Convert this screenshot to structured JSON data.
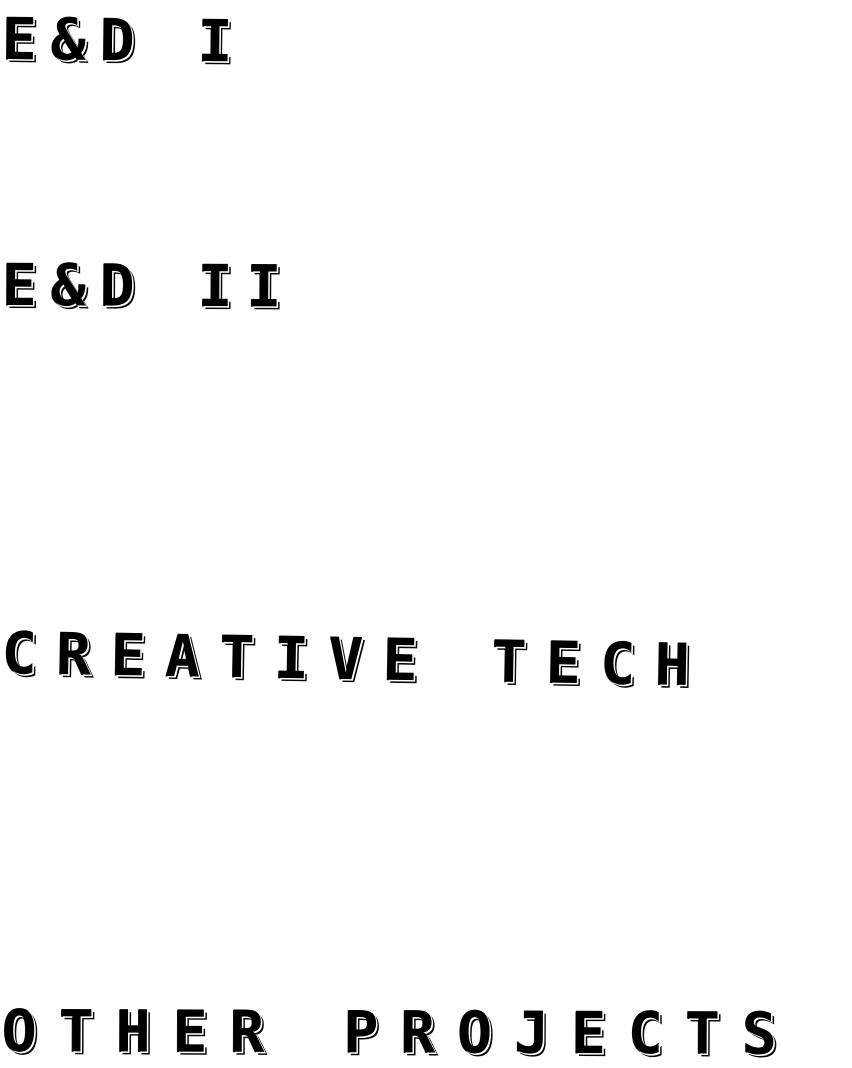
{
  "menu": {
    "items": [
      {
        "label": "E&D  I"
      },
      {
        "label": "E&D  II"
      },
      {
        "label": "CREATIVE TECH"
      },
      {
        "label": "OTHER PROJECTS"
      }
    ]
  }
}
